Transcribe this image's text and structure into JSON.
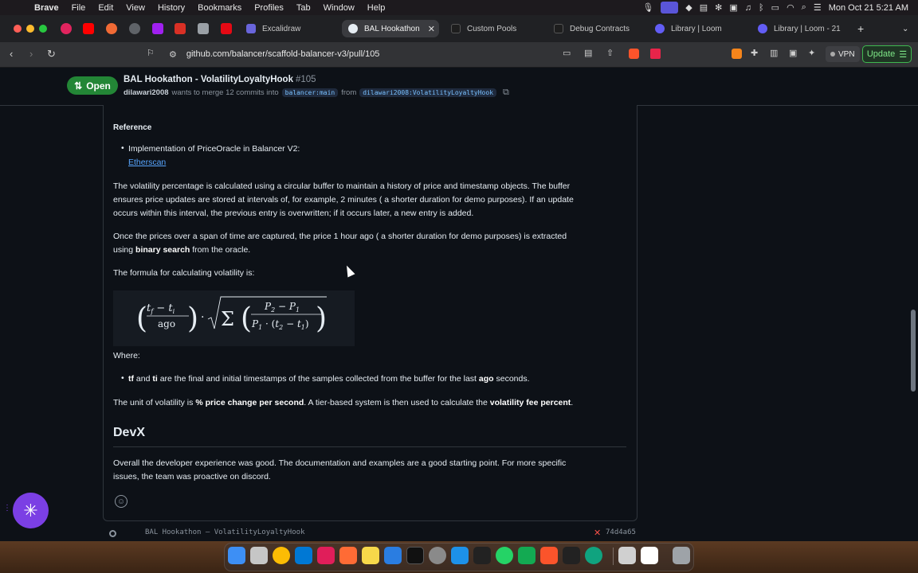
{
  "menubar": {
    "app": "Brave",
    "items": [
      "File",
      "Edit",
      "View",
      "History",
      "Bookmarks",
      "Profiles",
      "Tab",
      "Window",
      "Help"
    ],
    "clock": "Mon Oct 21  5:21 AM"
  },
  "tabs": [
    {
      "title": "Excalidraw",
      "color": "#6965db"
    },
    {
      "title": "BAL Hookathon",
      "color": "#e6edf3",
      "active": true
    },
    {
      "title": "Custom Pools",
      "color": "#1e1e1e"
    },
    {
      "title": "Debug Contracts",
      "color": "#1e1e1e"
    },
    {
      "title": "Library | Loom",
      "color": "#625df5"
    },
    {
      "title": "Library | Loom - 21",
      "color": "#625df5"
    }
  ],
  "toolbar": {
    "url": "github.com/balancer/scaffold-balancer-v3/pull/105",
    "vpn_label": "VPN",
    "update_label": "Update"
  },
  "pr": {
    "status": "Open",
    "title": "BAL Hookathon - VolatilityLoyaltyHook",
    "number": "#105",
    "author": "dilawari2008",
    "merge_text": "wants to merge 12 commits into",
    "base_branch": "balancer:main",
    "from_text": "from",
    "head_branch": "dilawari2008:VolatilityLoyaltyHook"
  },
  "body": {
    "reference_heading": "Reference",
    "ref_item_text": "Implementation of PriceOracle in Balancer V2:",
    "ref_item_link": "Etherscan",
    "p1_l1": "The volatility percentage is calculated using a circular buffer to maintain a history of price and timestamp objects. The buffer",
    "p1_l2": "ensures price updates are stored at intervals of, for example, 2 minutes ( a shorter duration for demo purposes). If an update",
    "p1_l3": "occurs within this interval, the previous entry is overwritten; if it occurs later, a new entry is added.",
    "p2_l1": "Once the prices over a span of time are captured, the price 1 hour ago ( a shorter duration for demo purposes) is extracted",
    "p2_pre": "using",
    "p2_bold": "binary search",
    "p2_post": "from the oracle.",
    "formula_intro": "The formula for calculating volatility is:",
    "where": "Where:",
    "w_tf": "tf",
    "w_and": "and",
    "w_ti": "ti",
    "w_mid": "are the final and initial timestamps of the samples collected from the buffer for the last",
    "w_ago": "ago",
    "w_end": "seconds.",
    "u_pre": "The unit of volatility is",
    "u_bold1": "% price change per second",
    "u_mid": ". A tier-based system is then used to calculate the",
    "u_bold2": "volatility fee percent",
    "u_end": ".",
    "devx_heading": "DevX",
    "devx_l1": "Overall the developer experience was good. The documentation and examples are a good starting point. For more specific",
    "devx_l2": "issues, the team was proactive on discord."
  },
  "formula": {
    "tf": "t",
    "tf_sub": "f",
    "ti": "t",
    "ti_sub": "i",
    "ago": "ago",
    "dot": "·",
    "sum": "Σ",
    "p2": "P",
    "p2_sub": "2",
    "p1": "P",
    "p1_sub": "1",
    "minus": "−",
    "den_p": "P",
    "den_p_sub": "1",
    "den_t2": "t",
    "den_t2_sub": "2",
    "den_t1": "t",
    "den_t1_sub": "1"
  },
  "commit": {
    "message": "BAL Hookathon – VolatilityLoyaltyHook",
    "sha": "74d4a65"
  }
}
